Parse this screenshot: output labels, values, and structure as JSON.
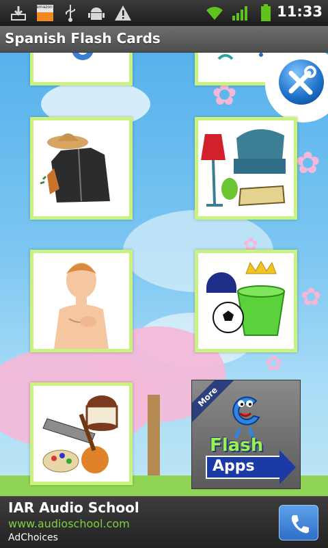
{
  "status_bar": {
    "time": "11:33",
    "notification_icons": [
      "download-icon",
      "amazon-appstore-icon",
      "usb-icon",
      "android-debug-icon",
      "warning-icon"
    ],
    "system_icons": [
      "wifi-icon",
      "signal-icon",
      "battery-icon"
    ],
    "amazon_label": "amazon"
  },
  "app": {
    "title": "Spanish Flash Cards"
  },
  "categories": [
    {
      "id": "partial-1",
      "icon": "partial-card-icon"
    },
    {
      "id": "partial-2",
      "icon": "partial-card-icon"
    },
    {
      "id": "clothing",
      "icon": "clothing-icon"
    },
    {
      "id": "furniture",
      "icon": "furniture-icon"
    },
    {
      "id": "body",
      "icon": "body-icon"
    },
    {
      "id": "toys",
      "icon": "toys-icon"
    },
    {
      "id": "music",
      "icon": "musical-instruments-icon"
    }
  ],
  "more_apps": {
    "ribbon": "More",
    "line1": "Flash",
    "line2": "Apps"
  },
  "settings": {
    "icon": "settings-tools-icon"
  },
  "ad": {
    "title": "IAR Audio School",
    "url": "www.audioschool.com",
    "choices": "AdChoices",
    "call_icon": "phone-icon"
  },
  "colors": {
    "card_border": "#c9f27e",
    "sky": "#56b2ec",
    "url_green": "#7fd040"
  }
}
